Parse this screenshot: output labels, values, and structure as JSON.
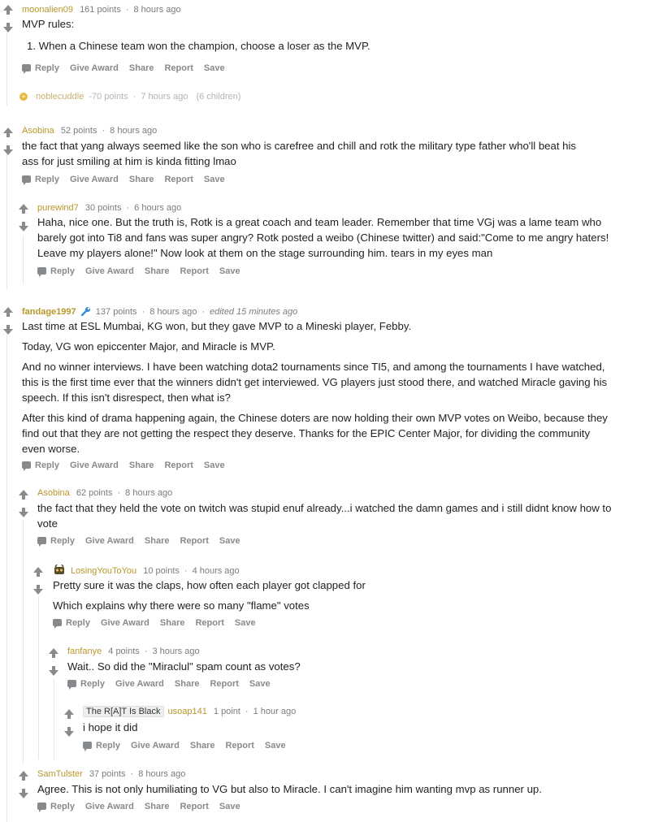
{
  "actions": {
    "reply": "Reply",
    "give_award": "Give Award",
    "share": "Share",
    "report": "Report",
    "save": "Save"
  },
  "comments": [
    {
      "author": "moonalien09",
      "points": "161 points",
      "time": "8 hours ago",
      "body": [
        "1. When a Chinese team won the champion, choose a loser as the MVP."
      ],
      "heading": "MVP rules:"
    },
    {
      "author": "noblecuddle",
      "points": "-70 points",
      "time": "7 hours ago",
      "children": "(6 children)"
    },
    {
      "author": "Asobina",
      "points": "52 points",
      "time": "8 hours ago",
      "body": [
        "the fact that yang always seemed like the son who is carefree and chill and rotk the military type father who'll beat his ass for just smiling at him is kinda fitting lmao"
      ]
    },
    {
      "author": "purewind7",
      "points": "30 points",
      "time": "6 hours ago",
      "body": [
        "Haha, nice one. But the truth is, Rotk is a great coach and team leader. Remember that time VGj was a lame team who barely got into Ti8 and fans was super angry? Rotk posted a weibo (Chinese twitter) and said:\"Come to me angry haters! Leave my players alone!\" Now look at them on the stage surrounding him. tears in my eyes man"
      ]
    },
    {
      "author": "fandage1997",
      "points": "137 points",
      "time": "8 hours ago",
      "edited": "edited 15 minutes ago",
      "body": [
        "Last time at ESL Mumbai, KG won, but they gave MVP to a Mineski player, Febby.",
        "Today, VG won epiccenter Major, and Miracle is MVP.",
        "And no winner interviews. I have been watching dota2 tournaments since TI5, and among the tournaments I have watched, this is the first time ever that the winners didn't get interviewed. VG players just stood there, and watched Miracle gaving his speech. If this isn't disrespect, then what is?",
        "After this kind of drama happening again, the Chinese doters are now holding their own MVP votes on Weibo, because they find out that they are not getting the respect they deserve. Thanks for the EPIC Center Major, for dividing the community even worse."
      ]
    },
    {
      "author": "Asobina",
      "points": "62 points",
      "time": "8 hours ago",
      "body": [
        "the fact that they held the vote on twitch was stupid enuf already...i watched the damn games and i still didnt know how to vote"
      ]
    },
    {
      "author": "LosingYouToYou",
      "points": "10 points",
      "time": "4 hours ago",
      "body": [
        "Pretty sure it was the claps, how often each player got clapped for",
        "Which explains why there were so many \"flame\" votes"
      ]
    },
    {
      "author": "fanfanye",
      "points": "4 points",
      "time": "3 hours ago",
      "body": [
        "Wait.. So did the \"Miraclul\" spam count as votes?"
      ]
    },
    {
      "author": "usoap141",
      "flair": "The R[A]T Is Black",
      "points": "1 point",
      "time": "1 hour ago",
      "body": [
        "i hope it did"
      ]
    },
    {
      "author": "SamTulster",
      "points": "37 points",
      "time": "8 hours ago",
      "body": [
        "Agree. This is not only humiliating to VG but also to Miracle. I can't imagine him wanting mvp as runner up."
      ]
    }
  ]
}
